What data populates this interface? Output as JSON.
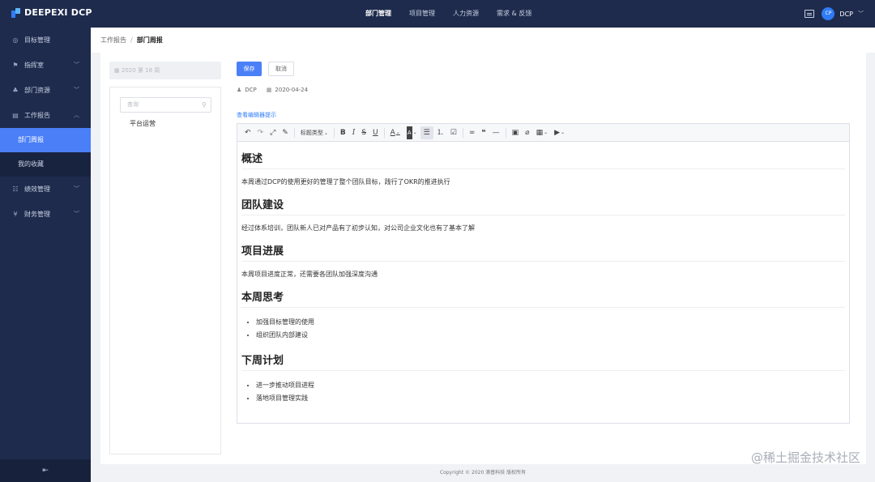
{
  "topbar": {
    "logo_text": "DEEPEXI DCP",
    "nav": [
      "部门管理",
      "项目管理",
      "人力资源",
      "需求 & 反馈"
    ],
    "avatar_initials": "CP",
    "user_name": "DCP"
  },
  "sidebar": {
    "items": [
      {
        "label": "目标管理",
        "icon": "target-icon"
      },
      {
        "label": "指挥室",
        "icon": "flag-icon"
      },
      {
        "label": "部门资源",
        "icon": "org-icon"
      },
      {
        "label": "工作报告",
        "icon": "document-icon"
      },
      {
        "label": "绩效管理",
        "icon": "performance-icon"
      },
      {
        "label": "财务管理",
        "icon": "yen-icon"
      }
    ],
    "sub_items": [
      "部门周报",
      "我的收藏"
    ],
    "collapse_icon": "collapse-menu-icon"
  },
  "breadcrumb": {
    "parent": "工作报告",
    "separator": "/",
    "current": "部门周报"
  },
  "week_select": {
    "icon": "calendar-icon",
    "value": "2020 第 18 周"
  },
  "tree": {
    "search_placeholder": "查询",
    "nodes": [
      "平台运营"
    ]
  },
  "actions": {
    "save": "保存",
    "cancel": "取消"
  },
  "meta": {
    "author": "DCP",
    "date": "2020-04-24"
  },
  "editor_hint": "查看编辑器提示",
  "toolbar": {
    "heading_select": "标题类型"
  },
  "document": {
    "sections": [
      {
        "heading": "概述",
        "paragraph": "本周通过DCP的使用更好的管理了整个团队目标，践行了OKR的推进执行"
      },
      {
        "heading": "团队建设",
        "paragraph": "经过体系培训，团队新人已对产品有了初步认知，对公司企业文化也有了基本了解"
      },
      {
        "heading": "项目进展",
        "paragraph": "本周项目进度正常，还需要各团队加强深度沟通"
      },
      {
        "heading": "本周思考",
        "bullets": [
          "加强目标管理的使用",
          "组织团队内部建设"
        ]
      },
      {
        "heading": "下周计划",
        "bullets": [
          "进一步推动项目进程",
          "落地项目管理实践"
        ]
      }
    ]
  },
  "footer": "Copyright © 2020 滴普科技 版权所有",
  "watermark": "@稀土掘金技术社区"
}
